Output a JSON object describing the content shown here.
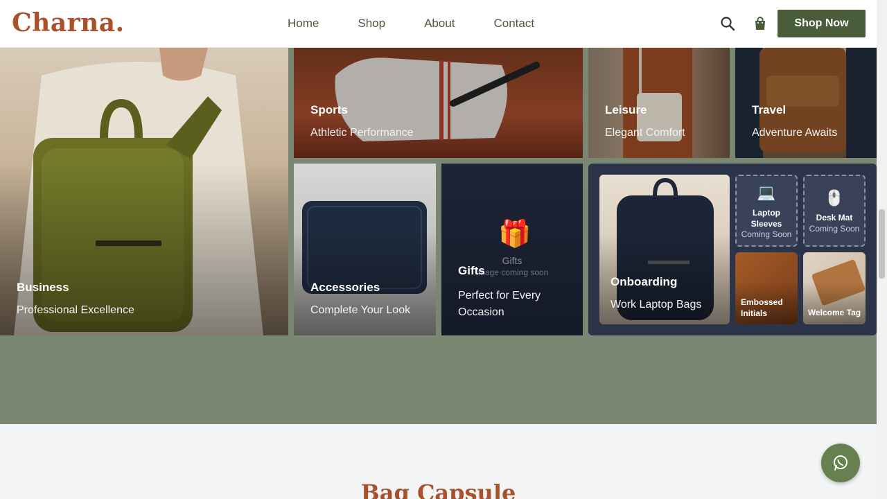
{
  "brand": {
    "logo": "Charna.",
    "accent": "#a8512a",
    "primary": "#4a5d3a"
  },
  "nav": {
    "items": [
      "Home",
      "Shop",
      "About",
      "Contact"
    ]
  },
  "header": {
    "cta": "Shop Now",
    "search_icon": "search-icon",
    "bag_icon": "shopping-bag-icon"
  },
  "tiles": {
    "business": {
      "title": "Business",
      "subtitle": "Professional Excellence"
    },
    "sports": {
      "title": "Sports",
      "subtitle": "Athletic Performance"
    },
    "leisure": {
      "title": "Leisure",
      "subtitle": "Elegant Comfort"
    },
    "travel": {
      "title": "Travel",
      "subtitle": "Adventure Awaits"
    },
    "accessories": {
      "title": "Accessories",
      "subtitle": "Complete Your Look"
    },
    "gifts": {
      "title": "Gifts",
      "subtitle": "Perfect for Every Occasion",
      "placeholder_name": "Gifts",
      "placeholder_note": "Image coming soon"
    },
    "onboarding": {
      "title": "Onboarding",
      "subtitle": "Work Laptop Bags",
      "items": [
        {
          "label": "Laptop Sleeves",
          "status": "Coming Soon",
          "icon": "laptop-icon"
        },
        {
          "label": "Desk Mat",
          "status": "Coming Soon",
          "icon": "mouse-icon"
        },
        {
          "label": "Embossed Initials"
        },
        {
          "label": "Welcome Tag"
        }
      ]
    }
  },
  "capsule": {
    "title": "Bag Capsule"
  },
  "float": {
    "icon": "whatsapp-icon"
  }
}
